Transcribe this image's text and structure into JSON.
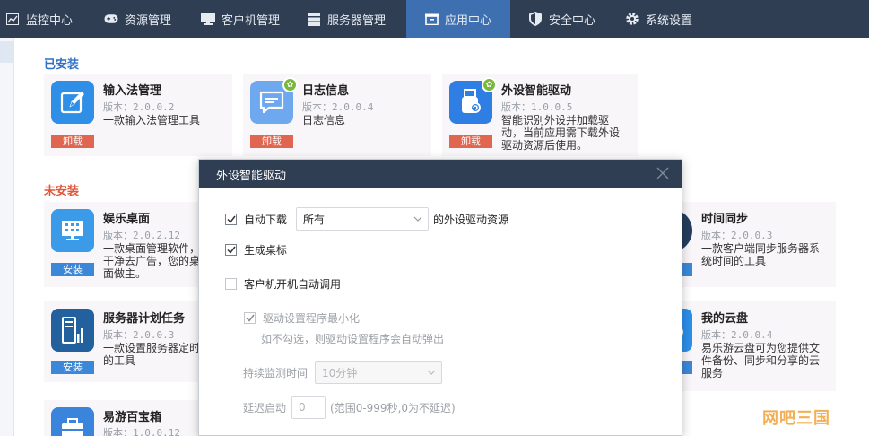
{
  "nav": {
    "items": [
      {
        "label": "监控中心",
        "icon": "monitor-chart-icon"
      },
      {
        "label": "资源管理",
        "icon": "gamepad-icon"
      },
      {
        "label": "客户机管理",
        "icon": "desktop-icon"
      },
      {
        "label": "服务器管理",
        "icon": "server-icon"
      },
      {
        "label": "应用中心",
        "icon": "app-box-icon"
      },
      {
        "label": "安全中心",
        "icon": "shield-icon"
      },
      {
        "label": "系统设置",
        "icon": "gear-icon"
      }
    ],
    "active_index": 4
  },
  "sections": {
    "installed_title": "已安装",
    "uninstalled_title": "未安装"
  },
  "installed": [
    {
      "name": "输入法管理",
      "version": "版本：2.0.0.2",
      "desc": "一款输入法管理工具",
      "button": "卸载"
    },
    {
      "name": "日志信息",
      "version": "版本：2.0.0.4",
      "desc": "日志信息",
      "button": "卸载"
    },
    {
      "name": "外设智能驱动",
      "version": "版本：1.0.0.5",
      "desc": "智能识别外设并加载驱动，当前应用需下载外设驱动资源后使用。",
      "button": "卸载"
    }
  ],
  "uninstalled": [
    {
      "name": "娱乐桌面",
      "version": "版本：2.0.2.12",
      "desc": "一款桌面管理软件，干净去广告，您的桌面做主。",
      "button": "安装"
    },
    {
      "name": "服务器计划任务",
      "version": "版本：2.0.0.3",
      "desc": "一款设置服务器定时的工具",
      "button": "安装"
    },
    {
      "name": "易游百宝箱",
      "version": "版本：1.0.0.12",
      "desc": "",
      "button": ""
    },
    {
      "name": "时间同步",
      "version": "版本：2.0.0.3",
      "desc": "一款客户端同步服务器系统时间的工具",
      "button": ""
    },
    {
      "name": "我的云盘",
      "version": "版本：2.0.0.4",
      "desc": "易乐游云盘可为您提供文件备份、同步和分享的云服务",
      "button": ""
    }
  ],
  "dialog": {
    "title": "外设智能驱动",
    "auto_download_label": "自动下载",
    "auto_download_value": "所有",
    "auto_download_suffix": "的外设驱动资源",
    "create_shortcut_label": "生成桌标",
    "boot_call_label": "客户机开机自动调用",
    "minimize_label": "驱动设置程序最小化",
    "minimize_hint": "如不勾选，则驱动设置程序会自动弹出",
    "monitor_label": "持续监测时间",
    "monitor_value": "10分钟",
    "delay_label": "延迟启动",
    "delay_value": "0",
    "delay_hint": "(范围0-999秒,0为不延迟)"
  },
  "watermark": "网吧三国",
  "colors": {
    "nav_bg": "#2f3e52",
    "nav_active": "#3d6fb1",
    "uninstall": "#e06650",
    "install": "#3b88d8",
    "installed_title": "#3170c4",
    "uninstalled_title": "#e0573b"
  }
}
